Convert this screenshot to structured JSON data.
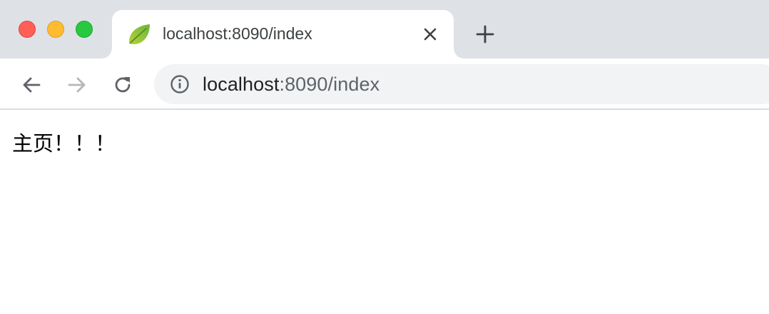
{
  "window": {
    "controls": [
      "close",
      "minimize",
      "zoom"
    ]
  },
  "tab": {
    "title": "localhost:8090/index",
    "favicon": "spring-leaf-icon"
  },
  "toolbar": {
    "back_icon": "arrow-left-icon",
    "forward_icon": "arrow-right-icon",
    "reload_icon": "reload-icon",
    "site_info_icon": "info-circle-icon",
    "url_host": "localhost",
    "url_rest": ":8090/index"
  },
  "page": {
    "text": "主页！！！"
  },
  "colors": {
    "tabstrip_bg": "#dee1e6",
    "omnibox_bg": "#f1f3f4",
    "close_red": "#ff5f57",
    "minimize_yellow": "#febc2e",
    "zoom_green": "#28c840",
    "spring_green": "#6db33f"
  }
}
